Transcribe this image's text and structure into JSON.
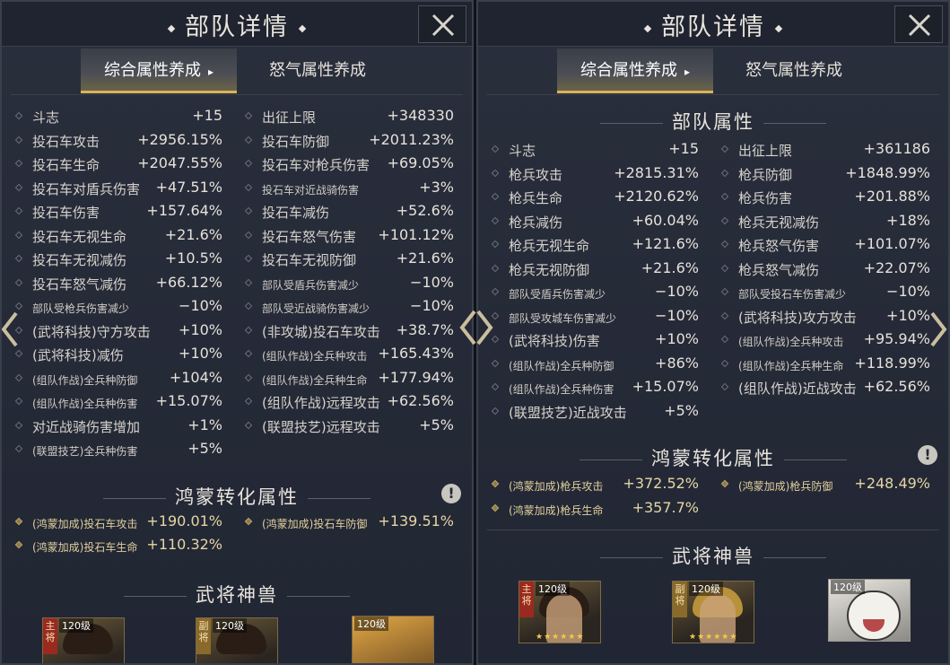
{
  "left": {
    "title": "部队详情",
    "tabs": [
      "综合属性养成",
      "怒气属性养成"
    ],
    "stats_left": [
      {
        "label": "斗志",
        "value": "+15",
        "small": false
      },
      {
        "label": "投石车攻击",
        "value": "+2956.15%",
        "small": false
      },
      {
        "label": "投石车生命",
        "value": "+2047.55%",
        "small": false
      },
      {
        "label": "投石车对盾兵伤害",
        "value": "+47.51%",
        "small": false
      },
      {
        "label": "投石车伤害",
        "value": "+157.64%",
        "small": false
      },
      {
        "label": "投石车无视生命",
        "value": "+21.6%",
        "small": false
      },
      {
        "label": "投石车无视减伤",
        "value": "+10.5%",
        "small": false
      },
      {
        "label": "投石车怒气减伤",
        "value": "+66.12%",
        "small": false
      },
      {
        "label": "部队受枪兵伤害减少",
        "value": "−10%",
        "small": true
      },
      {
        "label": "(武将科技)守方攻击",
        "value": "+10%",
        "small": false
      },
      {
        "label": "(武将科技)减伤",
        "value": "+10%",
        "small": false
      },
      {
        "label": "(组队作战)全兵种防御",
        "value": "+104%",
        "small": true
      },
      {
        "label": "(组队作战)全兵种伤害",
        "value": "+15.07%",
        "small": true
      },
      {
        "label": "对近战骑伤害增加",
        "value": "+1%",
        "small": false
      },
      {
        "label": "(联盟技艺)全兵种伤害",
        "value": "+5%",
        "small": true
      }
    ],
    "stats_right": [
      {
        "label": "出征上限",
        "value": "+348330",
        "small": false
      },
      {
        "label": "投石车防御",
        "value": "+2011.23%",
        "small": false
      },
      {
        "label": "投石车对枪兵伤害",
        "value": "+69.05%",
        "small": false
      },
      {
        "label": "投石车对近战骑伤害",
        "value": "+3%",
        "small": true
      },
      {
        "label": "投石车减伤",
        "value": "+52.6%",
        "small": false
      },
      {
        "label": "投石车怒气伤害",
        "value": "+101.12%",
        "small": false
      },
      {
        "label": "投石车无视防御",
        "value": "+21.6%",
        "small": false
      },
      {
        "label": "部队受盾兵伤害减少",
        "value": "−10%",
        "small": true
      },
      {
        "label": "部队受近战骑伤害减少",
        "value": "−10%",
        "small": true
      },
      {
        "label": "(非攻城)投石车攻击",
        "value": "+38.7%",
        "small": false
      },
      {
        "label": "(组队作战)全兵种攻击",
        "value": "+165.43%",
        "small": true
      },
      {
        "label": "(组队作战)全兵种生命",
        "value": "+177.94%",
        "small": true
      },
      {
        "label": "(组队作战)远程攻击",
        "value": "+62.56%",
        "small": false
      },
      {
        "label": "(联盟技艺)远程攻击",
        "value": "+5%",
        "small": false
      }
    ],
    "hongmeng_title": "鸿蒙转化属性",
    "hongmeng": [
      {
        "label": "(鸿蒙加成)投石车攻击",
        "value": "+190.01%"
      },
      {
        "label": "(鸿蒙加成)投石车防御",
        "value": "+139.51%"
      },
      {
        "label": "(鸿蒙加成)投石车生命",
        "value": "+110.32%"
      }
    ],
    "beast_title": "武将神兽",
    "cards": [
      {
        "level": "120级",
        "tag": "主将"
      },
      {
        "level": "120级",
        "tag": "副将"
      },
      {
        "level": "120级",
        "tag": ""
      }
    ]
  },
  "right": {
    "title": "部队详情",
    "tabs": [
      "综合属性养成",
      "怒气属性养成"
    ],
    "section_title": "部队属性",
    "stats_left": [
      {
        "label": "斗志",
        "value": "+15",
        "small": false
      },
      {
        "label": "枪兵攻击",
        "value": "+2815.31%",
        "small": false
      },
      {
        "label": "枪兵生命",
        "value": "+2120.62%",
        "small": false
      },
      {
        "label": "枪兵减伤",
        "value": "+60.04%",
        "small": false
      },
      {
        "label": "枪兵无视生命",
        "value": "+121.6%",
        "small": false
      },
      {
        "label": "枪兵无视防御",
        "value": "+21.6%",
        "small": false
      },
      {
        "label": "部队受盾兵伤害减少",
        "value": "−10%",
        "small": true
      },
      {
        "label": "部队受攻城车伤害减少",
        "value": "−10%",
        "small": true
      },
      {
        "label": "(武将科技)伤害",
        "value": "+10%",
        "small": false
      },
      {
        "label": "(组队作战)全兵种防御",
        "value": "+86%",
        "small": true
      },
      {
        "label": "(组队作战)全兵种伤害",
        "value": "+15.07%",
        "small": true
      },
      {
        "label": "(联盟技艺)近战攻击",
        "value": "+5%",
        "small": false
      }
    ],
    "stats_right": [
      {
        "label": "出征上限",
        "value": "+361186",
        "small": false
      },
      {
        "label": "枪兵防御",
        "value": "+1848.99%",
        "small": false
      },
      {
        "label": "枪兵伤害",
        "value": "+201.88%",
        "small": false
      },
      {
        "label": "枪兵无视减伤",
        "value": "+18%",
        "small": false
      },
      {
        "label": "枪兵怒气伤害",
        "value": "+101.07%",
        "small": false
      },
      {
        "label": "枪兵怒气减伤",
        "value": "+22.07%",
        "small": false
      },
      {
        "label": "部队受投石车伤害减少",
        "value": "−10%",
        "small": true
      },
      {
        "label": "(武将科技)攻方攻击",
        "value": "+10%",
        "small": false
      },
      {
        "label": "(组队作战)全兵种攻击",
        "value": "+95.94%",
        "small": true
      },
      {
        "label": "(组队作战)全兵种生命",
        "value": "+118.99%",
        "small": true
      },
      {
        "label": "(组队作战)近战攻击",
        "value": "+62.56%",
        "small": false
      }
    ],
    "hongmeng_title": "鸿蒙转化属性",
    "hongmeng": [
      {
        "label": "(鸿蒙加成)枪兵攻击",
        "value": "+372.52%"
      },
      {
        "label": "(鸿蒙加成)枪兵防御",
        "value": "+248.49%"
      },
      {
        "label": "(鸿蒙加成)枪兵生命",
        "value": "+357.7%"
      }
    ],
    "beast_title": "武将神兽",
    "cards": [
      {
        "level": "120级",
        "tag": "主将"
      },
      {
        "level": "120级",
        "tag": "副将"
      },
      {
        "level": "120级",
        "tag": ""
      }
    ]
  }
}
